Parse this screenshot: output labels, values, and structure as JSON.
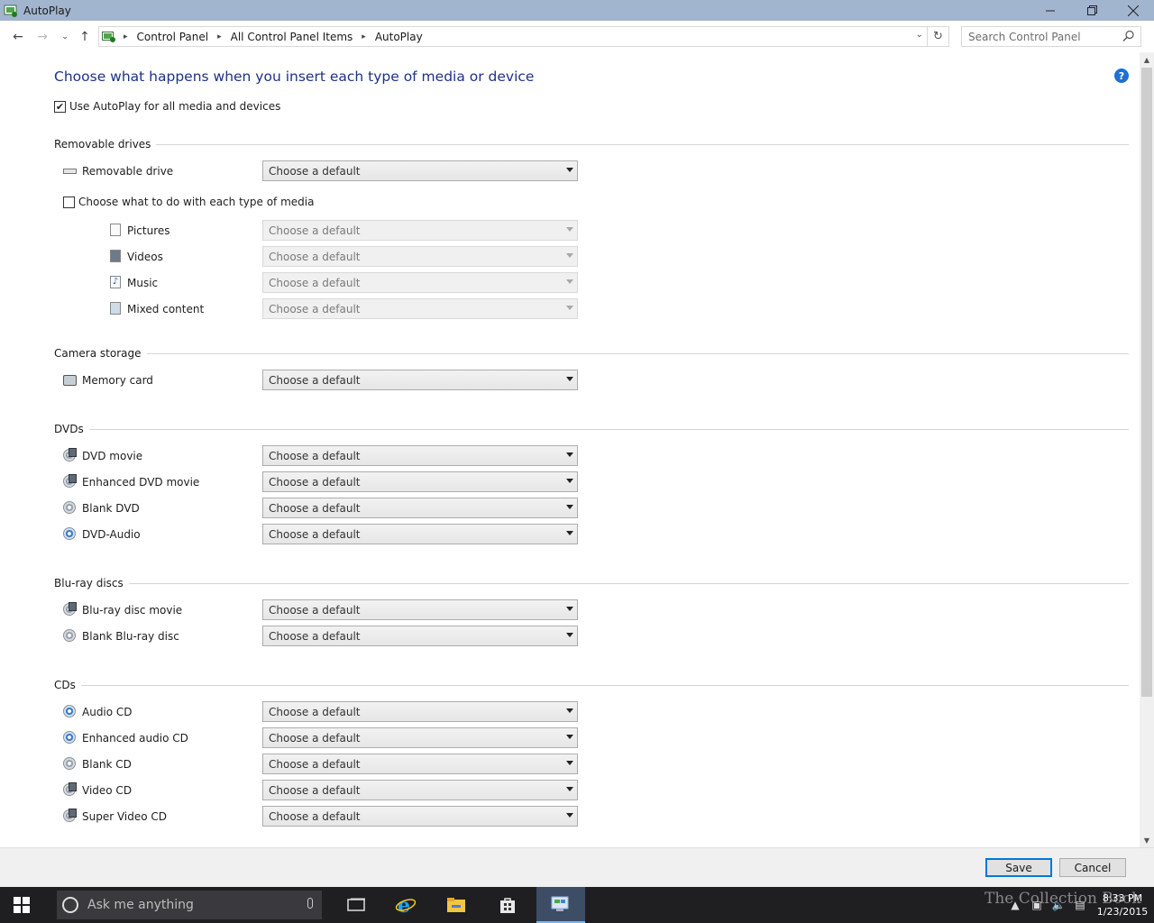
{
  "window": {
    "title": "AutoPlay"
  },
  "address": {
    "crumbs": [
      "Control Panel",
      "All Control Panel Items",
      "AutoPlay"
    ],
    "search_placeholder": "Search Control Panel"
  },
  "main": {
    "heading": "Choose what happens when you insert each type of media or device",
    "use_autoplay": {
      "label": "Use AutoPlay for all media and devices",
      "checked": true
    },
    "per_media": {
      "label": "Choose what to do with each type of media",
      "checked": false
    },
    "default_option": "Choose a default",
    "groups": {
      "removable": {
        "title": "Removable drives",
        "items": [
          "Removable drive"
        ]
      },
      "media": {
        "items": [
          "Pictures",
          "Videos",
          "Music",
          "Mixed content"
        ]
      },
      "camera": {
        "title": "Camera storage",
        "items": [
          "Memory card"
        ]
      },
      "dvds": {
        "title": "DVDs",
        "items": [
          "DVD movie",
          "Enhanced DVD movie",
          "Blank DVD",
          "DVD-Audio"
        ]
      },
      "bluray": {
        "title": "Blu-ray discs",
        "items": [
          "Blu-ray disc movie",
          "Blank Blu-ray disc"
        ]
      },
      "cds": {
        "title": "CDs",
        "items": [
          "Audio CD",
          "Enhanced audio CD",
          "Blank CD",
          "Video CD",
          "Super Video CD"
        ]
      }
    }
  },
  "buttons": {
    "save": "Save",
    "cancel": "Cancel"
  },
  "taskbar": {
    "search_placeholder": "Ask me anything",
    "time": "8:33 PM",
    "date": "1/23/2015",
    "watermark": "The Collection Book"
  },
  "colors": {
    "heading": "#1e3287",
    "titlebar": "#a2b5cf",
    "accent": "#0078d7",
    "taskbar": "#1f1f22"
  }
}
